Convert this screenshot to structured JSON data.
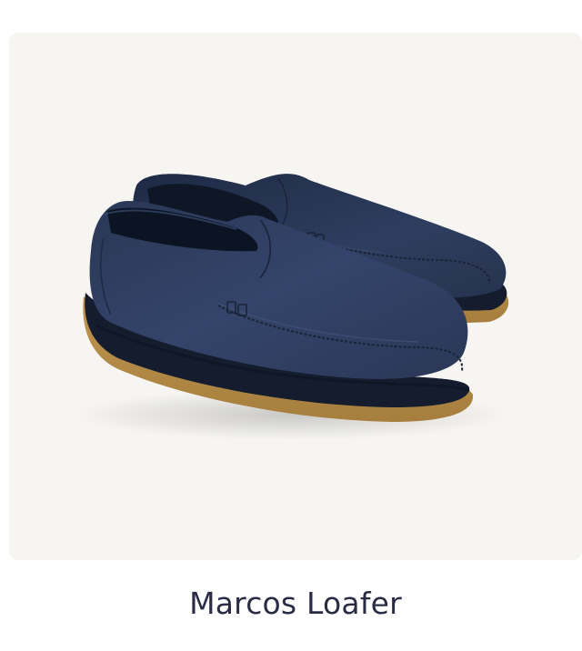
{
  "product": {
    "name": "Marcos Loafer",
    "image_icon": "navy-suede-loafers-product-photo",
    "colors": {
      "background": "#f6f5f2",
      "suede": "#2c3a58",
      "sole": "#b38a48",
      "title_text": "#2a2c45"
    }
  }
}
